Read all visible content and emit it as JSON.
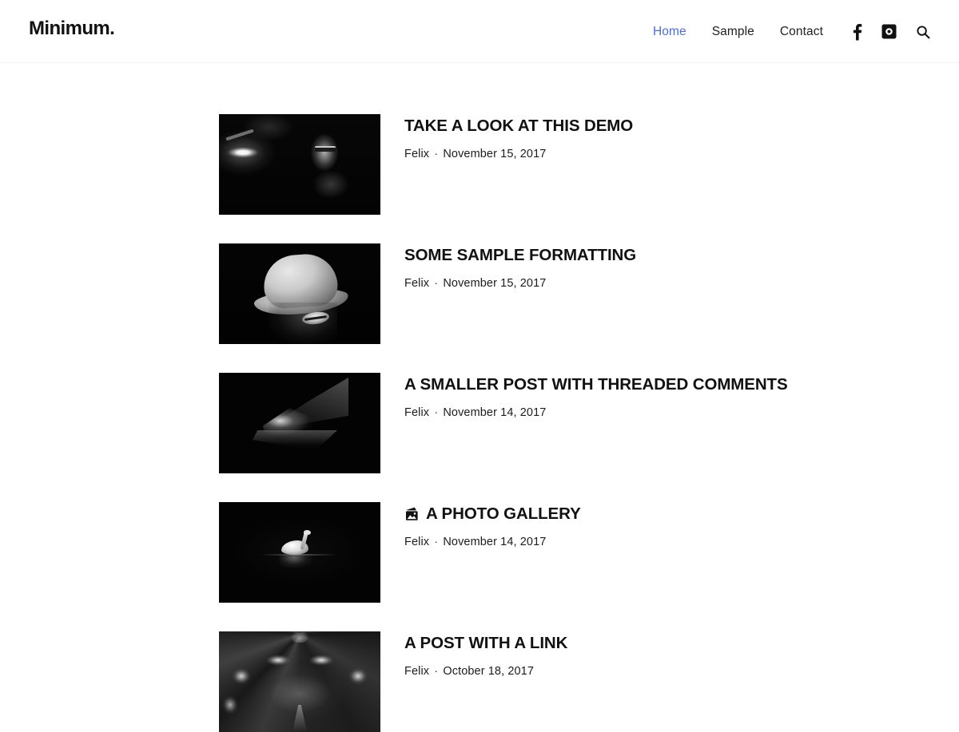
{
  "header": {
    "site_title": "Minimum.",
    "nav": [
      {
        "label": "Home",
        "active": true
      },
      {
        "label": "Sample",
        "active": false
      },
      {
        "label": "Contact",
        "active": false
      }
    ],
    "social": [
      {
        "name": "facebook-icon",
        "label": "Facebook"
      },
      {
        "name": "instagram-icon",
        "label": "Instagram"
      },
      {
        "name": "search-icon",
        "label": "Search"
      }
    ]
  },
  "posts": [
    {
      "title": "TAKE A LOOK AT THIS DEMO",
      "author": "Felix",
      "separator": "·",
      "date": "November 15, 2017",
      "format_icon": null,
      "thumb_alt": "Black and white photo of a person wearing glasses lit by a bright lamp"
    },
    {
      "title": "SOME SAMPLE FORMATTING",
      "author": "Felix",
      "separator": "·",
      "date": "November 15, 2017",
      "format_icon": null,
      "thumb_alt": "Black and white photo of a person in a bucket hat covering their eyes"
    },
    {
      "title": "A SMALLER POST WITH THREADED COMMENTS",
      "author": "Felix",
      "separator": "·",
      "date": "November 14, 2017",
      "format_icon": null,
      "thumb_alt": "Black and white photo of a triangular opening with light beyond it"
    },
    {
      "title": "A PHOTO GALLERY",
      "author": "Felix",
      "separator": "·",
      "date": "November 14, 2017",
      "format_icon": "gallery-icon",
      "thumb_alt": "Black and white photo of a swan on dark water with reflection"
    },
    {
      "title": "A POST WITH A LINK",
      "author": "Felix",
      "separator": "·",
      "date": "October 18, 2017",
      "format_icon": null,
      "thumb_alt": "Black and white photo of a cathedral vaulted ceiling"
    }
  ],
  "colors": {
    "accent": "#4a6ce0",
    "text": "#111111",
    "meta_text": "#1c1c1c",
    "background": "#ffffff",
    "header_border": "#f2f2f3"
  }
}
